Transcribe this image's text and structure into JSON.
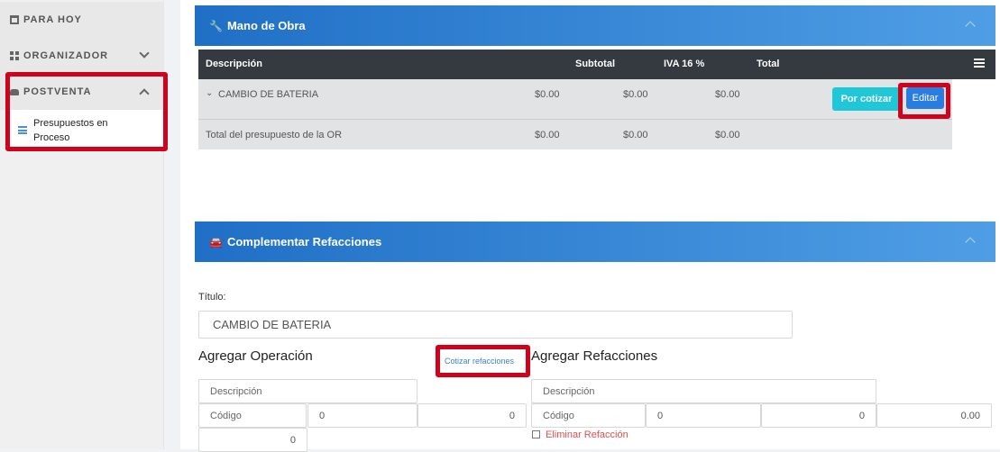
{
  "sidebar": {
    "items": [
      {
        "label": "PARA HOY",
        "icon": "calendar-icon"
      },
      {
        "label": "ORGANIZADOR",
        "icon": "grid-icon"
      },
      {
        "label": "POSTVENTA",
        "icon": "car-icon"
      }
    ],
    "sub_item": {
      "line1": "Presupuestos en",
      "line2": "Proceso",
      "icon": "list-check-icon"
    }
  },
  "mano_obra": {
    "title": "Mano de Obra",
    "columns": [
      "Descripción",
      "Subtotal",
      "IVA 16 %",
      "Total"
    ],
    "row": {
      "desc": "CAMBIO DE BATERIA",
      "c1": "$0.00",
      "c2": "$0.00",
      "c3": "$0.00"
    },
    "total": {
      "label": "Total del presupuesto de la OR",
      "c1": "$0.00",
      "c2": "$0.00",
      "c3": "$0.00"
    },
    "btn_cotizar": "Por cotizar",
    "btn_editar": "Editar"
  },
  "refacciones": {
    "title": "Complementar Refacciones",
    "titulo_label": "Título:",
    "titulo_value": "CAMBIO DE BATERIA",
    "agregar_operacion": "Agregar Operación",
    "cotizar_link": "Cotizar refacciones",
    "agregar_refacciones": "Agregar Refacciones",
    "op": {
      "desc_ph": "Descripción",
      "codigo_ph": "Código",
      "v1": "0",
      "v2": "0",
      "v3": "0"
    },
    "ref": {
      "desc_ph": "Descripción",
      "codigo_ph": "Código",
      "v1": "0",
      "v2": "0",
      "v3": "0.00"
    },
    "eliminar": "Eliminar Refacción"
  },
  "colors": {
    "accent": "#2a7de0",
    "highlight": "#d0021b",
    "info": "#1fc8d9"
  }
}
